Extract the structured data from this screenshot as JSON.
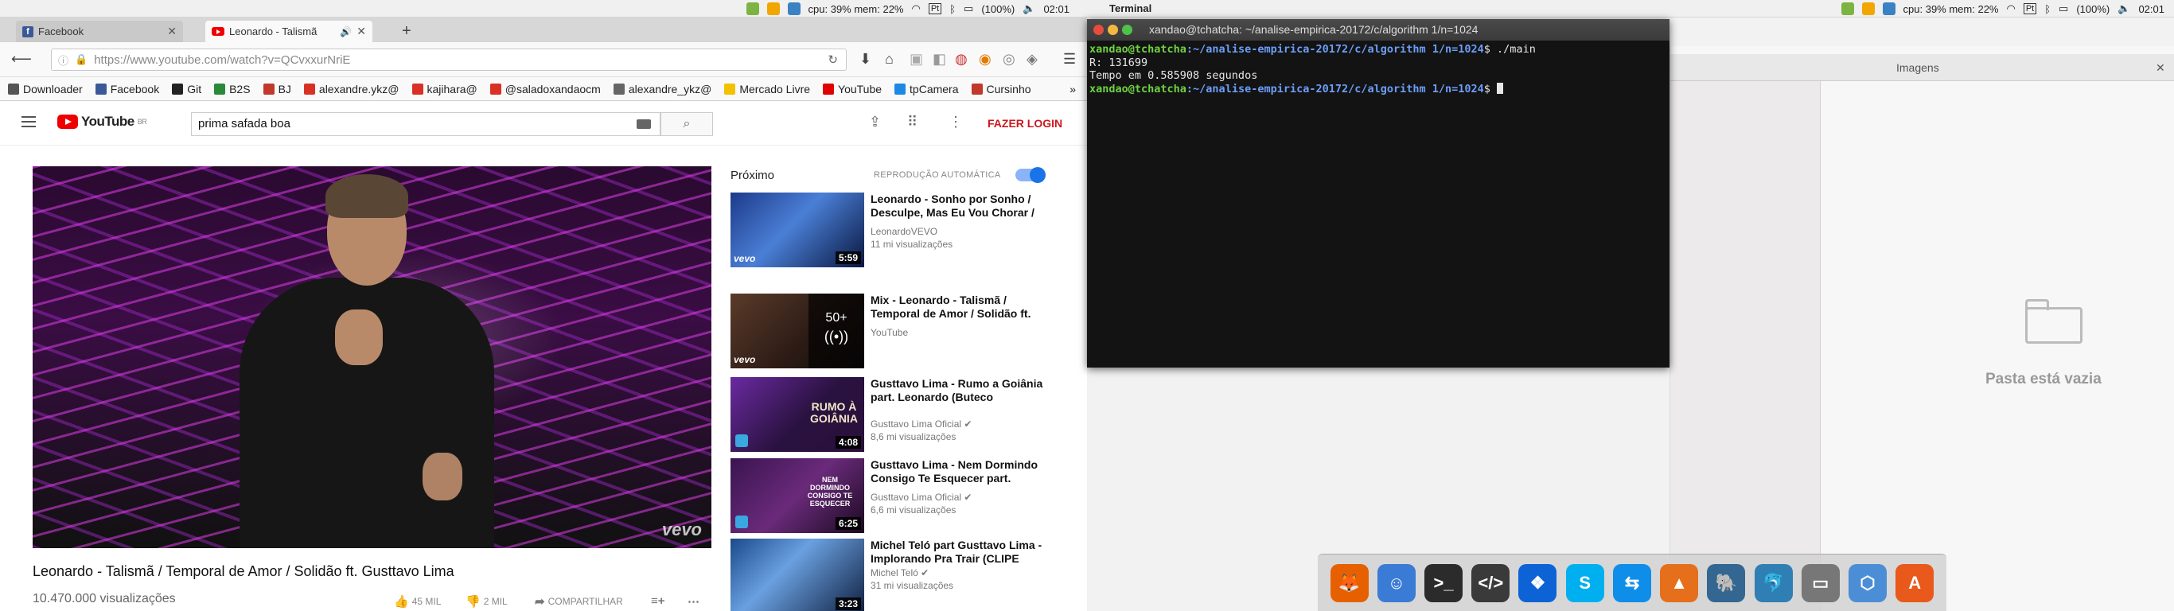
{
  "tray": {
    "cpu_mem": "cpu: 39% mem: 22%",
    "battery": "(100%)",
    "time": "02:01"
  },
  "panel_app": "Terminal",
  "browser": {
    "tabs": [
      {
        "label": "Facebook",
        "icon": "facebook-icon"
      },
      {
        "label": "Leonardo - Talismã",
        "icon": "youtube-icon"
      }
    ],
    "url": "https://www.youtube.com/watch?v=QCvxxurNriE",
    "bookmarks": [
      {
        "label": "Downloader",
        "icon": "gear-icon",
        "color": "#555555"
      },
      {
        "label": "Facebook",
        "icon": "facebook-icon",
        "color": "#3b5998"
      },
      {
        "label": "Git",
        "icon": "github-icon",
        "color": "#222222"
      },
      {
        "label": "B2S",
        "icon": "b2s-icon",
        "color": "#2a8a3a"
      },
      {
        "label": "BJ",
        "icon": "bj-icon",
        "color": "#c0392b"
      },
      {
        "label": "alexandre.ykz@",
        "icon": "gmail-icon",
        "color": "#d93025"
      },
      {
        "label": "kajihara@",
        "icon": "gmail-icon",
        "color": "#d93025"
      },
      {
        "label": "@saladoxandaocm",
        "icon": "gmail-icon",
        "color": "#d93025"
      },
      {
        "label": "alexandre_ykz@",
        "icon": "mail-icon",
        "color": "#666666"
      },
      {
        "label": "Mercado Livre",
        "icon": "mercadolivre-icon",
        "color": "#f2c200"
      },
      {
        "label": "YouTube",
        "icon": "youtube-icon",
        "color": "#e00000"
      },
      {
        "label": "tpCamera",
        "icon": "camera-icon",
        "color": "#1e88e5"
      },
      {
        "label": "Cursinho",
        "icon": "cursinho-icon",
        "color": "#c0392b"
      }
    ]
  },
  "youtube": {
    "search_value": "prima safada boa",
    "login_label": "FAZER LOGIN",
    "logo_text": "YouTube",
    "logo_region": "BR",
    "video": {
      "title": "Leonardo - Talismã / Temporal de Amor / Solidão ft. Gusttavo Lima",
      "views": "10.470.000 visualizações",
      "likes": "45 MIL",
      "dislikes": "2 MIL",
      "share": "COMPARTILHAR",
      "watermark": "vevo"
    },
    "up_next_label": "Próximo",
    "autoplay_label": "REPRODUÇÃO AUTOMÁTICA",
    "recommendations": [
      {
        "title": "Leonardo - Sonho por Sonho / Desculpe, Mas Eu Vou Chorar /",
        "channel": "LeonardoVEVO",
        "views": "11 mi visualizações",
        "duration": "5:59"
      },
      {
        "title": "Mix - Leonardo - Talismã / Temporal de Amor / Solidão ft.",
        "channel": "YouTube",
        "views": "",
        "duration": "",
        "mix_count": "50+"
      },
      {
        "title": "Gusttavo Lima - Rumo a Goiânia part. Leonardo (Buteco",
        "channel": "Gusttavo Lima Oficial",
        "views": "8,6 mi visualizações",
        "duration": "4:08",
        "thumb_text": "RUMO À GOIÂNIA"
      },
      {
        "title": "Gusttavo Lima - Nem Dormindo Consigo Te Esquecer part.",
        "channel": "Gusttavo Lima Oficial",
        "views": "6,6 mi visualizações",
        "duration": "6:25",
        "thumb_text": "NEM DORMINDO CONSIGO TE ESQUECER"
      },
      {
        "title": "Michel Teló part Gusttavo Lima - Implorando Pra Trair (CLIPE",
        "channel": "Michel Teló",
        "views": "31 mi visualizações",
        "duration": "3:23"
      }
    ]
  },
  "terminal": {
    "title": "xandao@tchatcha: ~/analise-empirica-20172/c/algorithm 1/n=1024",
    "lines": [
      {
        "user": "xandao@tchatcha",
        "path": ":~/analise-empirica-20172/c/algorithm 1/n=1024",
        "cmd": "$ ./main"
      },
      {
        "out": "R: 131699"
      },
      {
        "out": "Tempo em 0.585908 segundos"
      },
      {
        "user": "xandao@tchatcha",
        "path": ":~/analise-empirica-20172/c/algorithm 1/n=1024",
        "cmd": "$ "
      }
    ]
  },
  "files": {
    "tab_label": "Imagens",
    "empty_label": "Pasta está vazia"
  },
  "dock": [
    {
      "name": "firefox",
      "color": "#e66000",
      "glyph": "🦊"
    },
    {
      "name": "finder",
      "color": "#3a7bd5",
      "glyph": "☺"
    },
    {
      "name": "terminal",
      "color": "#2b2b2b",
      "glyph": ">_"
    },
    {
      "name": "code-editor",
      "color": "#3a3a3a",
      "glyph": "</>"
    },
    {
      "name": "dropbox",
      "color": "#0d63d6",
      "glyph": "❖"
    },
    {
      "name": "skype",
      "color": "#00aff0",
      "glyph": "S"
    },
    {
      "name": "teamviewer",
      "color": "#0e8ee9",
      "glyph": "⇆"
    },
    {
      "name": "matlab",
      "color": "#e56f1a",
      "glyph": "▲"
    },
    {
      "name": "postgresql",
      "color": "#336791",
      "glyph": "🐘"
    },
    {
      "name": "mysql-workbench",
      "color": "#2f7fb5",
      "glyph": "🐬"
    },
    {
      "name": "system-tool",
      "color": "#777777",
      "glyph": "▭"
    },
    {
      "name": "virtualbox",
      "color": "#4c8ed6",
      "glyph": "⬡"
    },
    {
      "name": "ubuntu-software",
      "color": "#e8591b",
      "glyph": "A"
    }
  ]
}
